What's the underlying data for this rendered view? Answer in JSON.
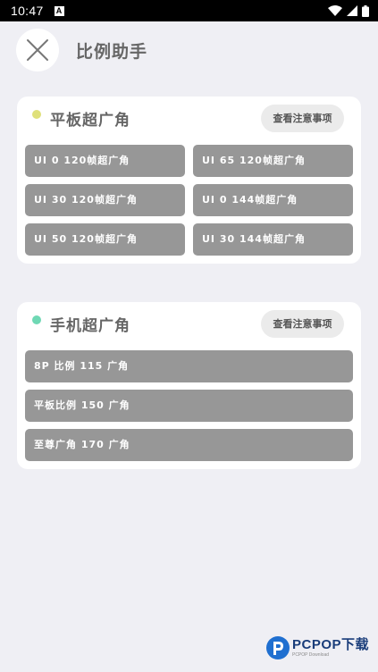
{
  "statusbar": {
    "time": "10:47",
    "notification_letter": "A"
  },
  "header": {
    "title": "比例助手"
  },
  "colors": {
    "tablet_dot": "#dfe07a",
    "phone_dot": "#6fd8b4",
    "option_bg": "#979797"
  },
  "sections": [
    {
      "title": "平板超广角",
      "notice_label": "查看注意事项",
      "options": [
        "UI 0 120帧超广角",
        "UI 65 120帧超广角",
        "UI 30 120帧超广角",
        "UI 0 144帧超广角",
        "UI 50 120帧超广角",
        "UI 30 144帧超广角"
      ]
    },
    {
      "title": "手机超广角",
      "notice_label": "查看注意事项",
      "options": [
        "8P 比例 115 广角",
        "平板比例 150 广角",
        "至尊广角 170 广角"
      ]
    }
  ],
  "watermark": {
    "main": "PCPOP下载",
    "sub": "PCPOP Download"
  }
}
